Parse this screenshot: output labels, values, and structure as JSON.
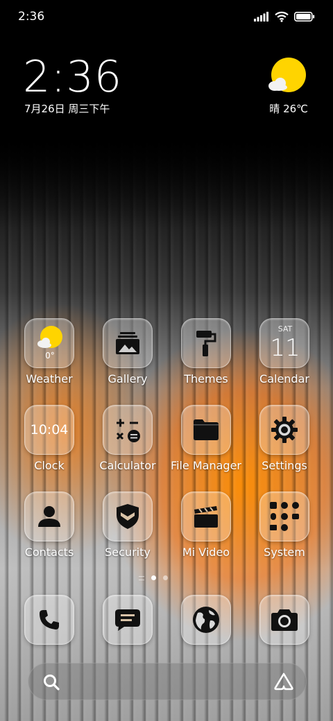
{
  "status_bar": {
    "time": "2:36"
  },
  "clock_widget": {
    "time": "2:36",
    "date": "7月26日 周三下午"
  },
  "weather_widget": {
    "text": "晴 26℃"
  },
  "apps": [
    {
      "label": "Weather",
      "icon": "weather-icon",
      "extra": "0°"
    },
    {
      "label": "Gallery",
      "icon": "gallery-icon"
    },
    {
      "label": "Themes",
      "icon": "paint-roller-icon"
    },
    {
      "label": "Calendar",
      "icon": "calendar-icon",
      "day": "SAT",
      "date": "11"
    },
    {
      "label": "Clock",
      "icon": "clock-icon",
      "extra": "10:04"
    },
    {
      "label": "Calculator",
      "icon": "calculator-icon"
    },
    {
      "label": "File Manager",
      "icon": "folder-icon"
    },
    {
      "label": "Settings",
      "icon": "gear-icon"
    },
    {
      "label": "Contacts",
      "icon": "person-icon"
    },
    {
      "label": "Security",
      "icon": "shield-icon"
    },
    {
      "label": "Mi Video",
      "icon": "clapperboard-icon"
    },
    {
      "label": "System",
      "icon": "folder-grid-icon"
    }
  ],
  "pager": {
    "pages": 2,
    "active_page": 1
  },
  "dock": [
    {
      "icon": "phone-icon"
    },
    {
      "icon": "message-icon"
    },
    {
      "icon": "browser-globe-icon"
    },
    {
      "icon": "camera-icon"
    }
  ],
  "colors": {
    "accent_orange": "#ff8c00",
    "weather_sun": "#ffd400"
  }
}
